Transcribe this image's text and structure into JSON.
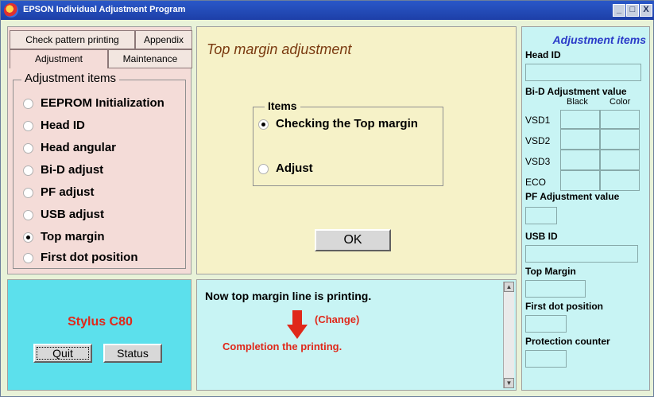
{
  "window": {
    "title": "EPSON Individual Adjustment Program"
  },
  "titlebar_buttons": [
    "_",
    "□",
    "X"
  ],
  "tabs": [
    {
      "label": "Check pattern printing"
    },
    {
      "label": "Appendix"
    },
    {
      "label": "Adjustment"
    },
    {
      "label": "Maintenance"
    }
  ],
  "adjustment_items": {
    "title": "Adjustment items",
    "options": [
      {
        "label": "EEPROM Initialization",
        "selected": false
      },
      {
        "label": "Head ID",
        "selected": false
      },
      {
        "label": "Head angular",
        "selected": false
      },
      {
        "label": "Bi-D adjust",
        "selected": false
      },
      {
        "label": "PF adjust",
        "selected": false
      },
      {
        "label": "USB adjust",
        "selected": false
      },
      {
        "label": "Top margin",
        "selected": true
      },
      {
        "label": "First dot position",
        "selected": false
      }
    ]
  },
  "main": {
    "title": "Top margin adjustment",
    "items_title": "Items",
    "items": [
      {
        "label": "Checking the Top margin",
        "selected": true
      },
      {
        "label": "Adjust",
        "selected": false
      }
    ],
    "ok_label": "OK"
  },
  "right_panel": {
    "title": "Adjustment items",
    "head_id_label": "Head ID",
    "bid_label": "Bi-D Adjustment value",
    "col_black": "Black",
    "col_color": "Color",
    "rows": [
      "VSD1",
      "VSD2",
      "VSD3",
      "ECO"
    ],
    "pf_label": "PF Adjustment value",
    "usb_label": "USB ID",
    "top_margin_label": "Top Margin",
    "first_dot_label": "First dot position",
    "protection_label": "Protection counter"
  },
  "model": {
    "name": "Stylus C80"
  },
  "buttons": {
    "quit": "Quit",
    "status": "Status"
  },
  "messages": {
    "line1": "Now top margin line is printing.",
    "change": "(Change)",
    "line3": "Completion the printing."
  },
  "colors": {
    "accent_red": "#e0281a",
    "title_blue": "#2a3ac8"
  }
}
